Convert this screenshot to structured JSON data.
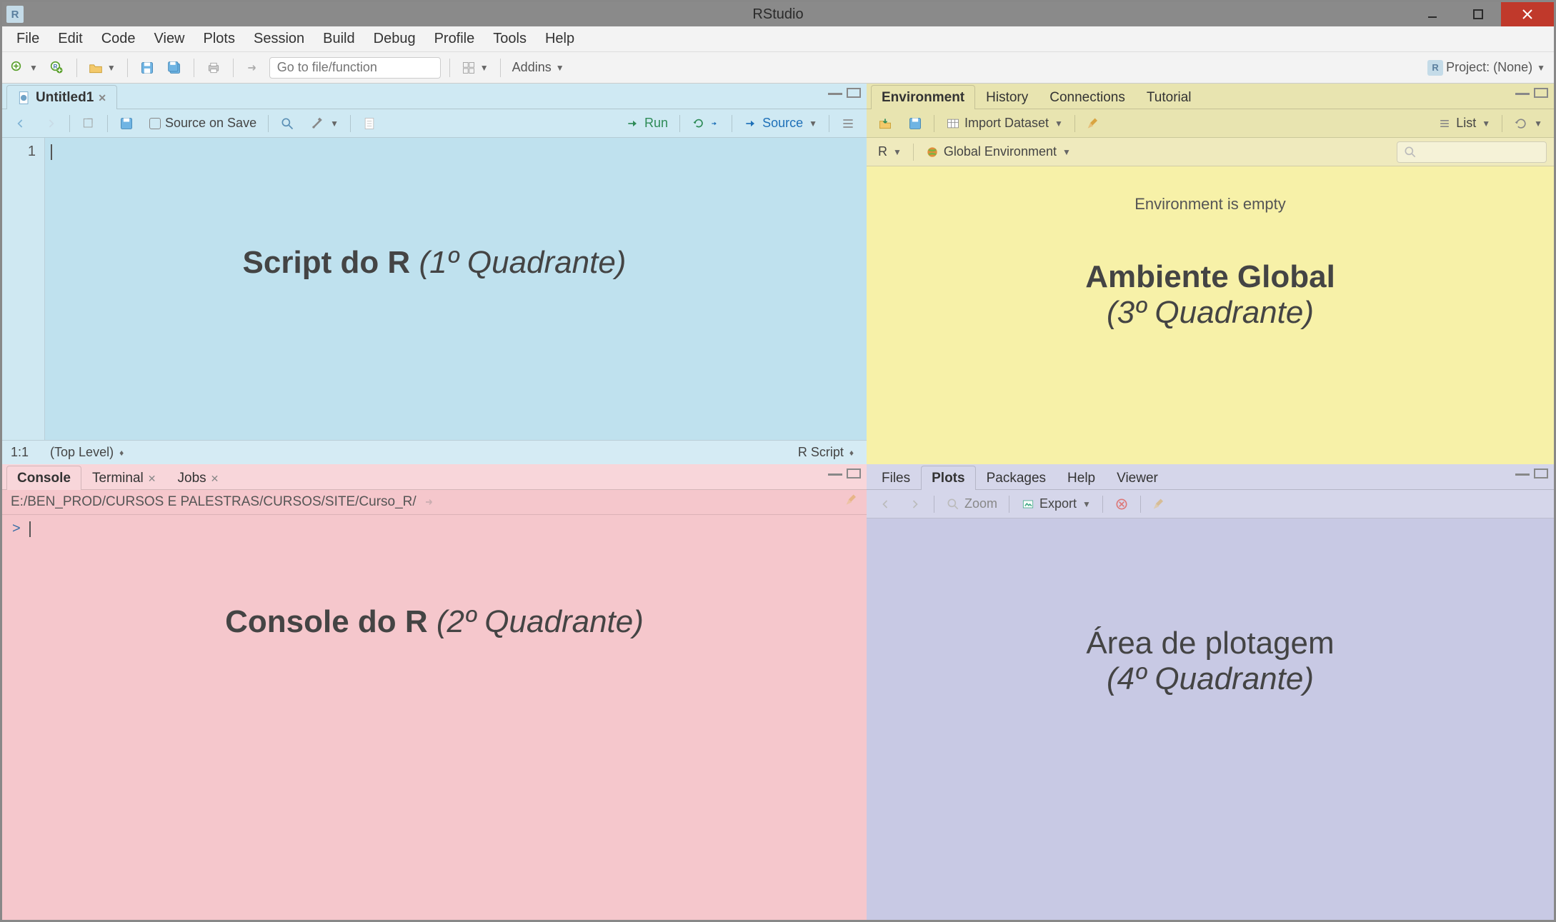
{
  "titlebar": {
    "title": "RStudio"
  },
  "menubar": [
    "File",
    "Edit",
    "Code",
    "View",
    "Plots",
    "Session",
    "Build",
    "Debug",
    "Profile",
    "Tools",
    "Help"
  ],
  "toolbar": {
    "gotofile_placeholder": "Go to file/function",
    "addins_label": "Addins",
    "project_label": "Project: (None)"
  },
  "q1": {
    "tab_label": "Untitled1",
    "source_on_save": "Source on Save",
    "run_label": "Run",
    "source_label": "Source",
    "line_number": "1",
    "status_pos": "1:1",
    "status_scope": "(Top Level)",
    "status_type": "R Script",
    "annotation_bold": "Script do R",
    "annotation_italic": "(1º Quadrante)"
  },
  "q2": {
    "tabs": [
      "Console",
      "Terminal",
      "Jobs"
    ],
    "active_tab": 0,
    "path": "E:/BEN_PROD/CURSOS E PALESTRAS/CURSOS/SITE/Curso_R/",
    "prompt": ">",
    "annotation_bold": "Console do R",
    "annotation_italic": "(2º Quadrante)"
  },
  "q3": {
    "tabs": [
      "Environment",
      "History",
      "Connections",
      "Tutorial"
    ],
    "active_tab": 0,
    "import_label": "Import Dataset",
    "list_label": "List",
    "lang_label": "R",
    "scope_label": "Global Environment",
    "empty_label": "Environment is empty",
    "annotation_bold": "Ambiente Global",
    "annotation_italic": "(3º Quadrante)"
  },
  "q4": {
    "tabs": [
      "Files",
      "Plots",
      "Packages",
      "Help",
      "Viewer"
    ],
    "active_tab": 1,
    "zoom_label": "Zoom",
    "export_label": "Export",
    "annotation_plain": "Área de plotagem",
    "annotation_italic": "(4º Quadrante)"
  }
}
